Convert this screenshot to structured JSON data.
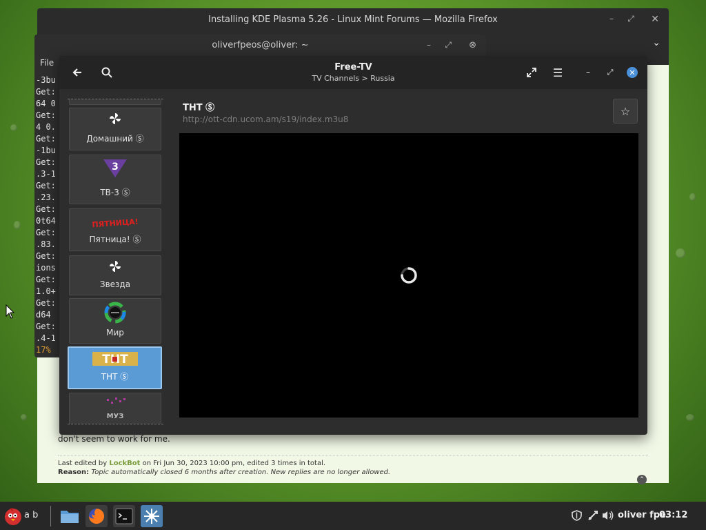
{
  "firefox": {
    "title": "Installing KDE Plasma 5.26 - Linux Mint Forums — Mozilla Firefox",
    "post_text": "don't seem to work for me.",
    "edit_prefix": "Last edited by ",
    "edit_user": "LockBot",
    "edit_suffix": " on Fri Jun 30, 2023 10:00 pm, edited 3 times in total.",
    "reason_label": "Reason:",
    "reason_text": "Topic automatically closed 6 months after creation. New replies are no longer allowed."
  },
  "terminal": {
    "title": "oliverfpeos@oliver: ~",
    "menu_file": "File",
    "lines": [
      "-3bu",
      "Get:",
      "64 0",
      "Get:",
      "4 0.",
      "Get:",
      "-1bu",
      "Get:",
      ".3-1",
      "Get:",
      ".23.",
      "Get:",
      "0t64",
      "Get:",
      ".83.",
      "Get:",
      "ions",
      "Get:",
      "1.0+",
      "Get:",
      "d64",
      "Get:",
      ".4-1"
    ],
    "progress": "17%"
  },
  "freetv": {
    "title": "Free-TV",
    "subtitle": "TV Channels > Russia",
    "channels": [
      {
        "label": "Домашний Ⓢ",
        "logo": "placeholder-logo"
      },
      {
        "label": "ТВ-3 Ⓢ",
        "logo": "tv3-logo"
      },
      {
        "label": "Пятница! Ⓢ",
        "logo": "pyatnitsa-logo"
      },
      {
        "label": "Звезда",
        "logo": "placeholder-logo"
      },
      {
        "label": "Мир",
        "logo": "mir-logo"
      },
      {
        "label": "ТНТ Ⓢ",
        "logo": "tnt-logo",
        "selected": true
      },
      {
        "label": "",
        "logo": "muz-logo"
      }
    ],
    "selected_channel": {
      "name": "ТНТ Ⓢ",
      "url": "http://ott-cdn.ucom.am/s19/index.m3u8"
    },
    "logo_text": {
      "tv3": "3",
      "pyatnitsa": "ПЯТНИЦА!",
      "tnt": "ТНТ",
      "muz": "МУЗ"
    }
  },
  "taskbar": {
    "workspace_label": "a b",
    "user": "oliver fpe",
    "clock": "03:12"
  },
  "colors": {
    "accent": "#5b9bd5",
    "close_blue": "#4a90d9",
    "page_bg": "#f1f8e6"
  }
}
